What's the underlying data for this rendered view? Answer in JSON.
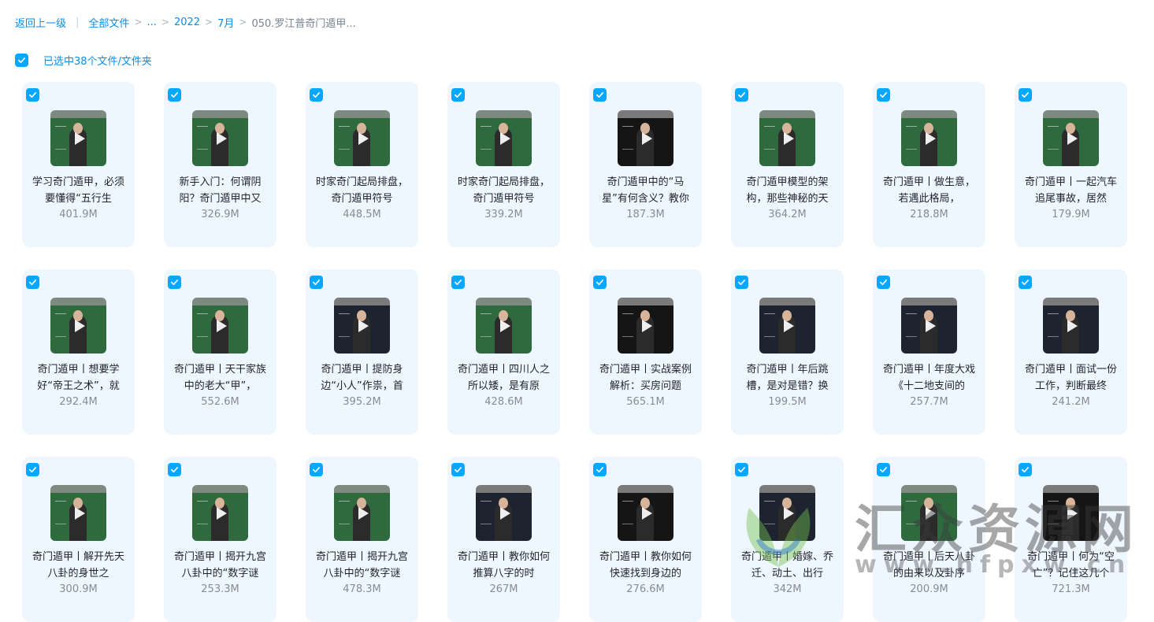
{
  "breadcrumb": {
    "back": "返回上一级",
    "root": "全部文件",
    "ellipsis": "...",
    "year": "2022",
    "month": "7月",
    "current": "050.罗江普奇门遁甲..."
  },
  "selection": {
    "text": "已选中38个文件/文件夹"
  },
  "files": [
    {
      "name": "学习奇门遁甲，必须要懂得“五行生",
      "size": "401.9M"
    },
    {
      "name": "新手入门：何谓阴阳？奇门遁甲中又",
      "size": "326.9M"
    },
    {
      "name": "时家奇门起局排盘，奇门遁甲符号",
      "size": "448.5M"
    },
    {
      "name": "时家奇门起局排盘，奇门遁甲符号",
      "size": "339.2M"
    },
    {
      "name": "奇门遁甲中的“马星”有何含义？教你",
      "size": "187.3M"
    },
    {
      "name": "奇门遁甲模型的架构，那些神秘的天",
      "size": "364.2M"
    },
    {
      "name": "奇门遁甲丨做生意，若遇此格局，",
      "size": "218.8M"
    },
    {
      "name": "奇门遁甲丨一起汽车追尾事故，居然",
      "size": "179.9M"
    },
    {
      "name": "奇门遁甲丨想要学好“帝王之术”，就",
      "size": "292.4M"
    },
    {
      "name": "奇门遁甲丨天干家族中的老大“甲”，",
      "size": "552.6M"
    },
    {
      "name": "奇门遁甲丨提防身边“小人”作祟，首",
      "size": "395.2M"
    },
    {
      "name": "奇门遁甲丨四川人之所以矮，是有原",
      "size": "428.6M"
    },
    {
      "name": "奇门遁甲丨实战案例解析：买房问题",
      "size": "565.1M"
    },
    {
      "name": "奇门遁甲丨年后跳槽，是对是错？换",
      "size": "199.5M"
    },
    {
      "name": "奇门遁甲丨年度大戏《十二地支间的",
      "size": "257.7M"
    },
    {
      "name": "奇门遁甲丨面试一份工作，判断最终",
      "size": "241.2M"
    },
    {
      "name": "奇门遁甲丨解开先天八卦的身世之",
      "size": "300.9M"
    },
    {
      "name": "奇门遁甲丨揭开九宫八卦中的“数字谜",
      "size": "253.3M"
    },
    {
      "name": "奇门遁甲丨揭开九宫八卦中的“数字谜",
      "size": "478.3M"
    },
    {
      "name": "奇门遁甲丨教你如何推算八字的时",
      "size": "267M"
    },
    {
      "name": "奇门遁甲丨教你如何快速找到身边的",
      "size": "276.6M"
    },
    {
      "name": "奇门遁甲丨婚嫁、乔迁、动土、出行",
      "size": "342M"
    },
    {
      "name": "奇门遁甲丨后天八卦的由来以及卦序",
      "size": "200.9M"
    },
    {
      "name": "奇门遁甲丨何为“空亡”？记住这几个",
      "size": "721.3M"
    }
  ],
  "watermark": {
    "text": "汇众资源网",
    "url": "www.hfpxw.cn"
  },
  "colors": {
    "accent": "#06a7ff",
    "link": "#0a8ce8",
    "card_bg": "#eef7ff"
  },
  "icons": {
    "check": "check-icon",
    "play": "play-icon"
  }
}
